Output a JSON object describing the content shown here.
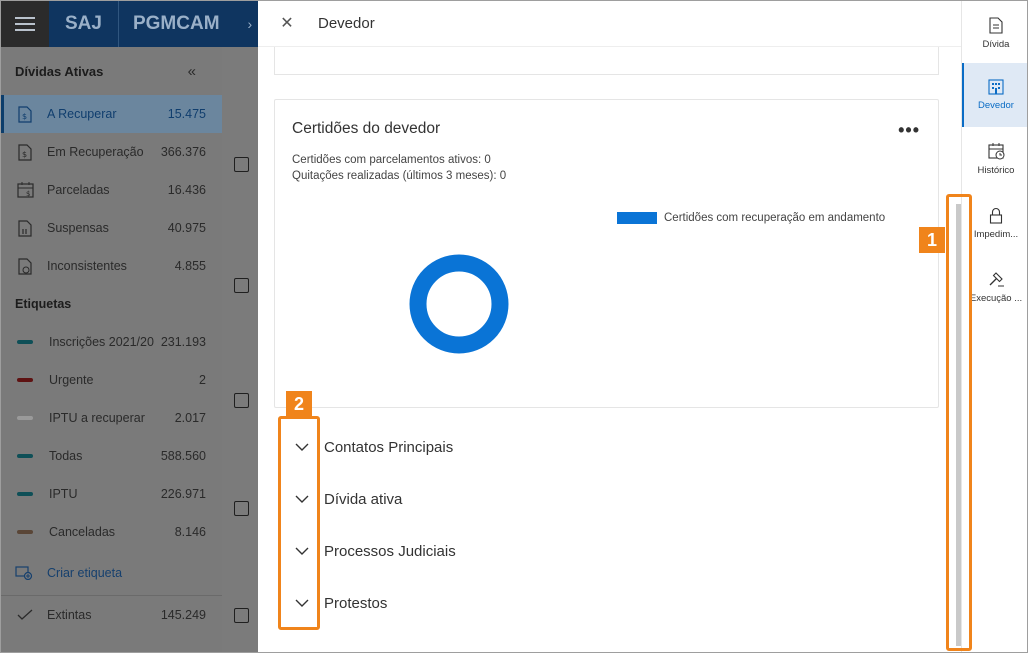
{
  "topbar": {
    "brand_saj": "SAJ",
    "brand_app": "PGMCAM",
    "chevron": "›"
  },
  "sidebar": {
    "header": "Dívidas Ativas",
    "collapse_icon": "«",
    "items": [
      {
        "label": "A Recuperar",
        "count": "15.475",
        "icon": "money-doc-icon",
        "active": true
      },
      {
        "label": "Em Recuperação",
        "count": "366.376",
        "icon": "money-doc-icon"
      },
      {
        "label": "Parceladas",
        "count": "16.436",
        "icon": "calendar-money-icon"
      },
      {
        "label": "Suspensas",
        "count": "40.975",
        "icon": "paused-doc-icon"
      },
      {
        "label": "Inconsistentes",
        "count": "4.855",
        "icon": "warning-doc-icon"
      }
    ],
    "tags_header": "Etiquetas",
    "tags": [
      {
        "label": "Inscrições 2021/20...",
        "count": "231.193",
        "color": "#0e4f57"
      },
      {
        "label": "Urgente",
        "count": "2",
        "color": "#5e1212"
      },
      {
        "label": "IPTU a recuperar",
        "count": "2.017",
        "color": "#9a9a9a"
      },
      {
        "label": "Todas",
        "count": "588.560",
        "color": "#0e4f57"
      },
      {
        "label": "IPTU",
        "count": "226.971",
        "color": "#0e4f57"
      },
      {
        "label": "Canceladas",
        "count": "8.146",
        "color": "#5a4637"
      }
    ],
    "create_tag": "Criar etiqueta",
    "extinct": {
      "label": "Extintas",
      "count": "145.249"
    }
  },
  "panel": {
    "title": "Devedor",
    "certidoes": {
      "title": "Certidões do devedor",
      "line1": "Certidões com parcelamentos ativos: 0",
      "line2": "Quitações realizadas (últimos 3 meses): 0",
      "legend": "Certidões com recuperação em andamento",
      "legend_color": "#0a74d6",
      "more": "•••"
    },
    "accordions": [
      {
        "label": "Contatos Principais"
      },
      {
        "label": "Dívida ativa"
      },
      {
        "label": "Processos Judiciais"
      },
      {
        "label": "Protestos"
      }
    ]
  },
  "rail": {
    "items": [
      {
        "label": "Dívida",
        "icon": "document-icon"
      },
      {
        "label": "Devedor",
        "icon": "building-icon",
        "active": true
      },
      {
        "label": "Histórico",
        "icon": "calendar-clock-icon"
      },
      {
        "label": "Impedim...",
        "icon": "lock-icon"
      },
      {
        "label": "Execução ...",
        "icon": "gavel-icon"
      }
    ]
  },
  "annotations": {
    "badge1": "1",
    "badge2": "2",
    "color": "#f0841b"
  }
}
